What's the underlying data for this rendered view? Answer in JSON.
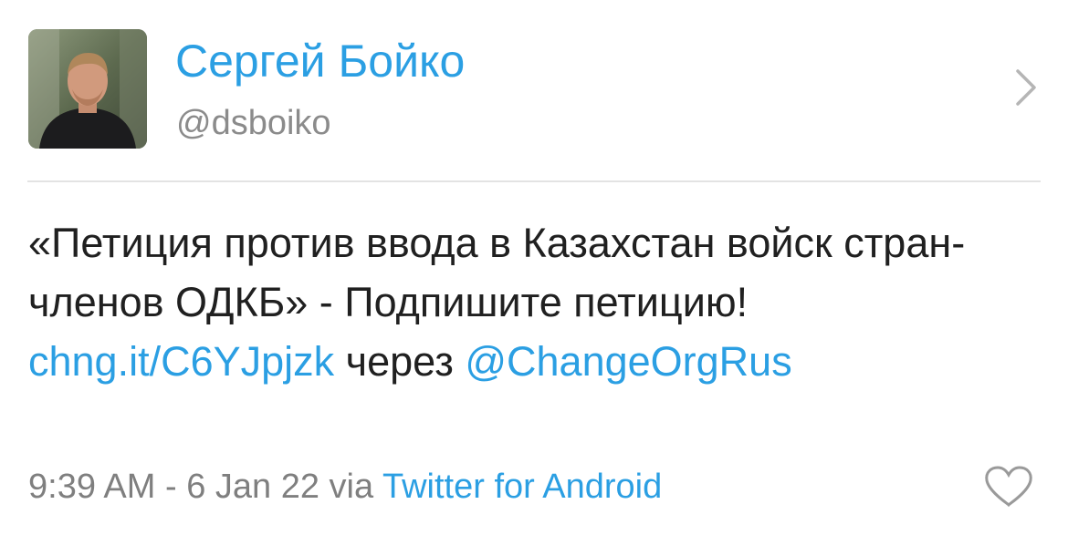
{
  "profile": {
    "display_name": "Сергей Бойко",
    "handle": "@dsboiko"
  },
  "tweet": {
    "text_part1": "«Петиция против ввода в Казахстан войск стран-членов ОДКБ» - Подпишите петицию! ",
    "link_text": "chng.it/C6YJpjzk",
    "text_part2": " через ",
    "mention_text": "@ChangeOrgRus"
  },
  "meta": {
    "timestamp": "9:39 AM - 6 Jan 22",
    "via_text": " via ",
    "client": "Twitter for Android"
  },
  "icons": {
    "chevron": "chevron-right-icon",
    "like": "heart-icon"
  },
  "colors": {
    "accent": "#2b9fe3",
    "secondary_text": "#8b8b8b",
    "primary_text": "#202020",
    "divider": "#e3e3e3"
  }
}
